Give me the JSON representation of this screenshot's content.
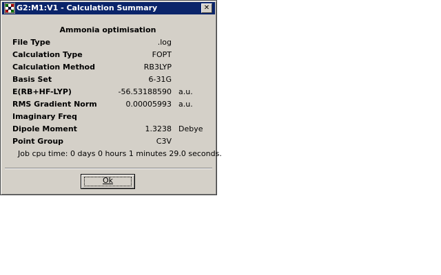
{
  "window": {
    "title": "G2:M1:V1 - Calculation Summary",
    "close_label": "✕"
  },
  "summary": {
    "heading": "Ammonia optimisation",
    "rows": [
      {
        "label": "File Type",
        "value": ".log",
        "unit": ""
      },
      {
        "label": "Calculation Type",
        "value": "FOPT",
        "unit": ""
      },
      {
        "label": "Calculation Method",
        "value": "RB3LYP",
        "unit": ""
      },
      {
        "label": "Basis Set",
        "value": "6-31G",
        "unit": ""
      },
      {
        "label": "E(RB+HF-LYP)",
        "value": "-56.53188590",
        "unit": "a.u."
      },
      {
        "label": "RMS Gradient Norm",
        "value": "0.00005993",
        "unit": "a.u."
      },
      {
        "label": "Imaginary Freq",
        "value": "",
        "unit": ""
      },
      {
        "label": "Dipole Moment",
        "value": "1.3238",
        "unit": "Debye"
      },
      {
        "label": "Point Group",
        "value": "C3V",
        "unit": ""
      }
    ],
    "cpu_time": "Job cpu time:  0 days  0 hours  1 minutes 29.0 seconds."
  },
  "buttons": {
    "ok_label": "Ok"
  }
}
